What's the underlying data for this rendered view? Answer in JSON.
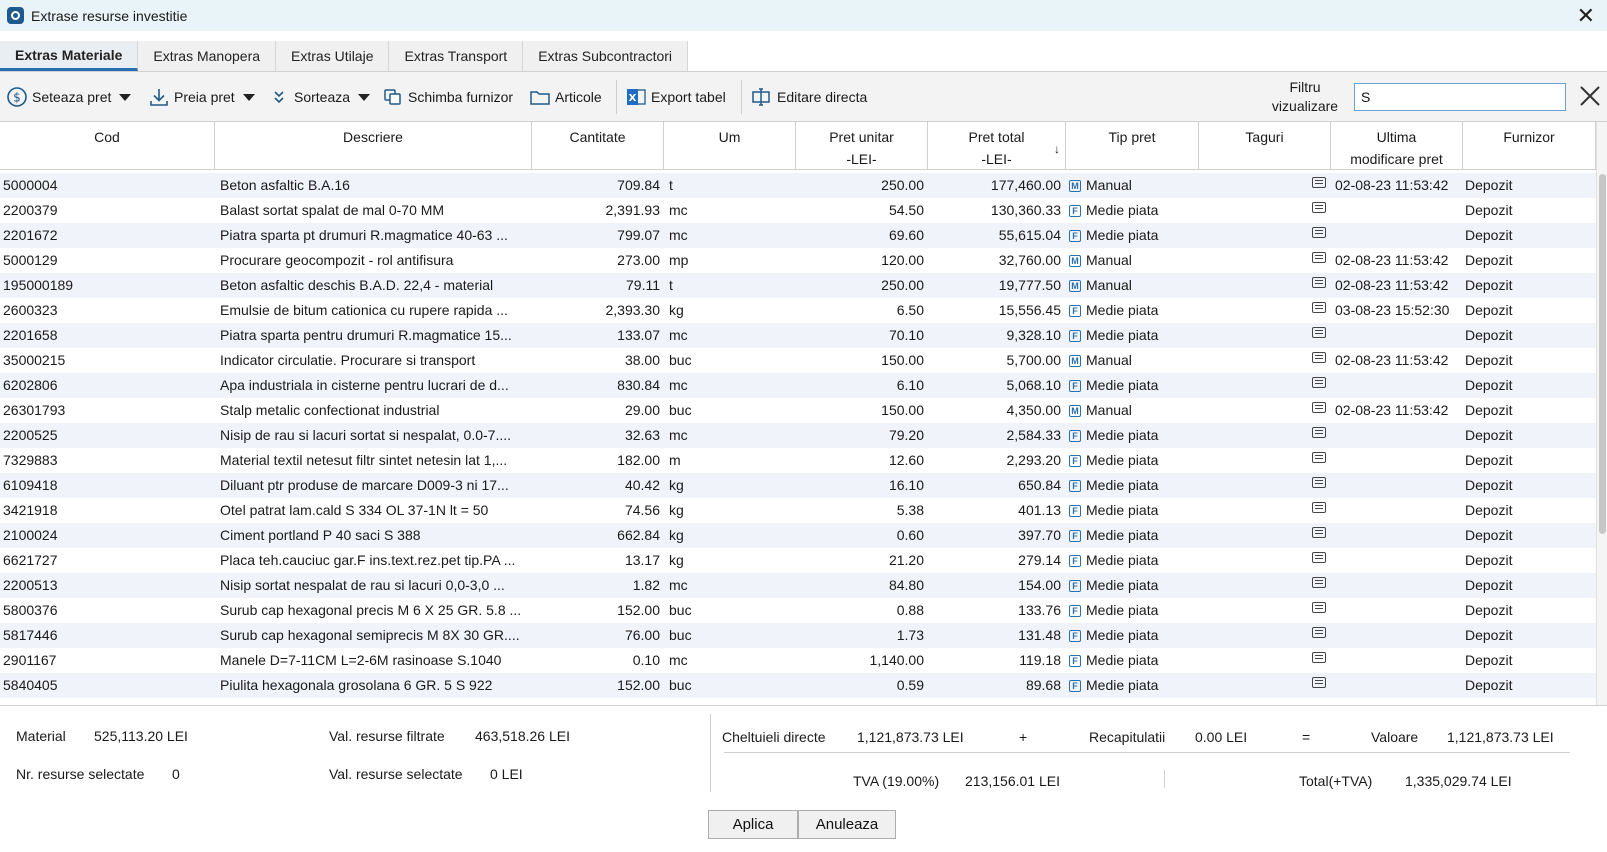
{
  "window": {
    "title": "Extrase resurse investitie"
  },
  "tabs": [
    {
      "label": "Extras Materiale",
      "active": true
    },
    {
      "label": "Extras Manopera",
      "active": false
    },
    {
      "label": "Extras Utilaje",
      "active": false
    },
    {
      "label": "Extras Transport",
      "active": false
    },
    {
      "label": "Extras Subcontractori",
      "active": false
    }
  ],
  "toolbar": {
    "seteaza_pret": "Seteaza pret",
    "preia_pret": "Preia pret",
    "sorteaza": "Sorteaza",
    "schimba_furnizor": "Schimba furnizor",
    "articole": "Articole",
    "export_tabel": "Export tabel",
    "editare_directa": "Editare directa",
    "filter_label_line1": "Filtru",
    "filter_label_line2": "vizualizare",
    "filter_value": "S"
  },
  "columns": {
    "cod": "Cod",
    "descriere": "Descriere",
    "cantitate": "Cantitate",
    "um": "Um",
    "pret_unitar_1": "Pret unitar",
    "pret_unitar_2": "-LEI-",
    "pret_total_1": "Pret total",
    "pret_total_2": "-LEI-",
    "sort_indicator": "↓",
    "tip_pret": "Tip pret",
    "taguri": "Taguri",
    "ultima_1": "Ultima",
    "ultima_2": "modificare pret",
    "furnizor": "Furnizor"
  },
  "rows": [
    {
      "cod": "5000004",
      "descriere": "Beton asfaltic B.A.16",
      "cantitate": "709.84",
      "um": "t",
      "pret_unitar": "250.00",
      "pret_total": "177,460.00",
      "tip_icon": "M",
      "tip_pret": "Manual",
      "ultima": "02-08-23 11:53:42",
      "furnizor": "Depozit"
    },
    {
      "cod": "2200379",
      "descriere": "Balast sortat spalat de mal 0-70 MM",
      "cantitate": "2,391.93",
      "um": "mc",
      "pret_unitar": "54.50",
      "pret_total": "130,360.33",
      "tip_icon": "F",
      "tip_pret": "Medie piata",
      "ultima": "",
      "furnizor": "Depozit"
    },
    {
      "cod": "2201672",
      "descriere": "Piatra sparta pt drumuri R.magmatice 40-63 ...",
      "cantitate": "799.07",
      "um": "mc",
      "pret_unitar": "69.60",
      "pret_total": "55,615.04",
      "tip_icon": "F",
      "tip_pret": "Medie piata",
      "ultima": "",
      "furnizor": "Depozit"
    },
    {
      "cod": "5000129",
      "descriere": "Procurare geocompozit - rol antifisura",
      "cantitate": "273.00",
      "um": "mp",
      "pret_unitar": "120.00",
      "pret_total": "32,760.00",
      "tip_icon": "M",
      "tip_pret": "Manual",
      "ultima": "02-08-23 11:53:42",
      "furnizor": "Depozit"
    },
    {
      "cod": "195000189",
      "descriere": "Beton asfaltic deschis B.A.D. 22,4 - material",
      "cantitate": "79.11",
      "um": "t",
      "pret_unitar": "250.00",
      "pret_total": "19,777.50",
      "tip_icon": "M",
      "tip_pret": "Manual",
      "ultima": "02-08-23 11:53:42",
      "furnizor": "Depozit"
    },
    {
      "cod": "2600323",
      "descriere": "Emulsie de bitum cationica cu rupere rapida ...",
      "cantitate": "2,393.30",
      "um": "kg",
      "pret_unitar": "6.50",
      "pret_total": "15,556.45",
      "tip_icon": "F",
      "tip_pret": "Medie piata",
      "ultima": "03-08-23 15:52:30",
      "furnizor": "Depozit"
    },
    {
      "cod": "2201658",
      "descriere": "Piatra sparta pentru drumuri R.magmatice 15...",
      "cantitate": "133.07",
      "um": "mc",
      "pret_unitar": "70.10",
      "pret_total": "9,328.10",
      "tip_icon": "F",
      "tip_pret": "Medie piata",
      "ultima": "",
      "furnizor": "Depozit"
    },
    {
      "cod": "35000215",
      "descriere": "Indicator circulatie. Procurare si transport",
      "cantitate": "38.00",
      "um": "buc",
      "pret_unitar": "150.00",
      "pret_total": "5,700.00",
      "tip_icon": "M",
      "tip_pret": "Manual",
      "ultima": "02-08-23 11:53:42",
      "furnizor": "Depozit"
    },
    {
      "cod": "6202806",
      "descriere": "Apa industriala in cisterne pentru lucrari de d...",
      "cantitate": "830.84",
      "um": "mc",
      "pret_unitar": "6.10",
      "pret_total": "5,068.10",
      "tip_icon": "F",
      "tip_pret": "Medie piata",
      "ultima": "",
      "furnizor": "Depozit"
    },
    {
      "cod": "26301793",
      "descriere": "Stalp metalic confectionat industrial",
      "cantitate": "29.00",
      "um": "buc",
      "pret_unitar": "150.00",
      "pret_total": "4,350.00",
      "tip_icon": "M",
      "tip_pret": "Manual",
      "ultima": "02-08-23 11:53:42",
      "furnizor": "Depozit"
    },
    {
      "cod": "2200525",
      "descriere": "Nisip de rau si lacuri sortat si nespalat, 0.0-7....",
      "cantitate": "32.63",
      "um": "mc",
      "pret_unitar": "79.20",
      "pret_total": "2,584.33",
      "tip_icon": "F",
      "tip_pret": "Medie piata",
      "ultima": "",
      "furnizor": "Depozit"
    },
    {
      "cod": "7329883",
      "descriere": "Material textil netesut filtr sintet netesin lat 1,...",
      "cantitate": "182.00",
      "um": "m",
      "pret_unitar": "12.60",
      "pret_total": "2,293.20",
      "tip_icon": "F",
      "tip_pret": "Medie piata",
      "ultima": "",
      "furnizor": "Depozit"
    },
    {
      "cod": "6109418",
      "descriere": "Diluant ptr produse de marcare D009-3 ni 17...",
      "cantitate": "40.42",
      "um": "kg",
      "pret_unitar": "16.10",
      "pret_total": "650.84",
      "tip_icon": "F",
      "tip_pret": "Medie piata",
      "ultima": "",
      "furnizor": "Depozit"
    },
    {
      "cod": "3421918",
      "descriere": "Otel patrat lam.cald S 334 OL 37-1N lt = 50",
      "cantitate": "74.56",
      "um": "kg",
      "pret_unitar": "5.38",
      "pret_total": "401.13",
      "tip_icon": "F",
      "tip_pret": "Medie piata",
      "ultima": "",
      "furnizor": "Depozit"
    },
    {
      "cod": "2100024",
      "descriere": "Ciment portland P 40 saci S 388",
      "cantitate": "662.84",
      "um": "kg",
      "pret_unitar": "0.60",
      "pret_total": "397.70",
      "tip_icon": "F",
      "tip_pret": "Medie piata",
      "ultima": "",
      "furnizor": "Depozit"
    },
    {
      "cod": "6621727",
      "descriere": "Placa teh.cauciuc gar.F ins.text.rez.pet tip.PA ...",
      "cantitate": "13.17",
      "um": "kg",
      "pret_unitar": "21.20",
      "pret_total": "279.14",
      "tip_icon": "F",
      "tip_pret": "Medie piata",
      "ultima": "",
      "furnizor": "Depozit"
    },
    {
      "cod": "2200513",
      "descriere": "Nisip sortat nespalat de rau si lacuri 0,0-3,0 ...",
      "cantitate": "1.82",
      "um": "mc",
      "pret_unitar": "84.80",
      "pret_total": "154.00",
      "tip_icon": "F",
      "tip_pret": "Medie piata",
      "ultima": "",
      "furnizor": "Depozit"
    },
    {
      "cod": "5800376",
      "descriere": "Surub cap hexagonal precis M 6 X 25 GR. 5.8 ...",
      "cantitate": "152.00",
      "um": "buc",
      "pret_unitar": "0.88",
      "pret_total": "133.76",
      "tip_icon": "F",
      "tip_pret": "Medie piata",
      "ultima": "",
      "furnizor": "Depozit"
    },
    {
      "cod": "5817446",
      "descriere": "Surub cap hexagonal semiprecis M 8X 30 GR....",
      "cantitate": "76.00",
      "um": "buc",
      "pret_unitar": "1.73",
      "pret_total": "131.48",
      "tip_icon": "F",
      "tip_pret": "Medie piata",
      "ultima": "",
      "furnizor": "Depozit"
    },
    {
      "cod": "2901167",
      "descriere": "Manele D=7-11CM L=2-6M rasinoase S.1040",
      "cantitate": "0.10",
      "um": "mc",
      "pret_unitar": "1,140.00",
      "pret_total": "119.18",
      "tip_icon": "F",
      "tip_pret": "Medie piata",
      "ultima": "",
      "furnizor": "Depozit"
    },
    {
      "cod": "5840405",
      "descriere": "Piulita hexagonala grosolana 6 GR. 5 S 922",
      "cantitate": "152.00",
      "um": "buc",
      "pret_unitar": "0.59",
      "pret_total": "89.68",
      "tip_icon": "F",
      "tip_pret": "Medie piata",
      "ultima": "",
      "furnizor": "Depozit"
    }
  ],
  "summary": {
    "material_label": "Material",
    "material_value": "525,113.20 LEI",
    "nr_sel_label": "Nr. resurse selectate",
    "nr_sel_value": "0",
    "val_filtrate_label": "Val. resurse filtrate",
    "val_filtrate_value": "463,518.26 LEI",
    "val_sel_label": "Val. resurse selectate",
    "val_sel_value": "0 LEI",
    "chelt_label": "Cheltuieli directe",
    "chelt_value": "1,121,873.73 LEI",
    "plus": "+",
    "recap_label": "Recapitulatii",
    "recap_value": "0.00 LEI",
    "equals": "=",
    "valoare_label": "Valoare",
    "valoare_value": "1,121,873.73 LEI",
    "tva_label": "TVA (19.00%)",
    "tva_value": "213,156.01 LEI",
    "total_label": "Total(+TVA)",
    "total_value": "1,335,029.74 LEI"
  },
  "buttons": {
    "aplica": "Aplica",
    "anuleaza": "Anuleaza"
  }
}
